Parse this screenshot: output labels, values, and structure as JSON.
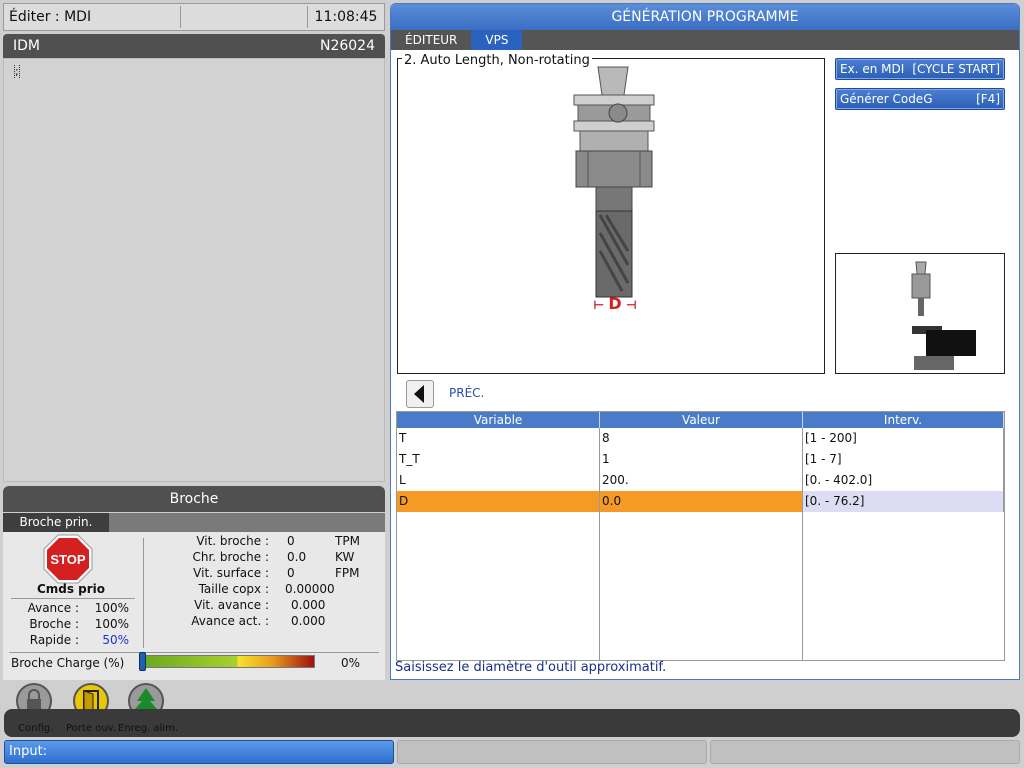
{
  "topbar": {
    "title": "Éditer : MDI",
    "clock": "11:08:45"
  },
  "idm": {
    "label": "IDM",
    "line": "N26024",
    "cursor_char": ";"
  },
  "broche": {
    "title": "Broche",
    "tab": "Broche prin.",
    "stop_label": "STOP",
    "cmds_label": "Cmds prio",
    "overrides": [
      {
        "label": "Avance :",
        "value": "100%"
      },
      {
        "label": "Broche :",
        "value": "100%"
      },
      {
        "label": "Rapide :",
        "value": "50%"
      }
    ],
    "stats": [
      {
        "label": "Vit. broche :",
        "value": "0",
        "unit": "TPM"
      },
      {
        "label": "Chr. broche :",
        "value": "0.0",
        "unit": "KW"
      },
      {
        "label": "Vit. surface :",
        "value": "0",
        "unit": "FPM"
      },
      {
        "label": "Taille copx :",
        "value": "0.00000",
        "unit": ""
      },
      {
        "label": "Vit. avance :",
        "value": "0.000",
        "unit": ""
      },
      {
        "label": "Avance act. :",
        "value": "0.000",
        "unit": ""
      }
    ],
    "charge_label": "Broche Charge (%)",
    "charge_value": "0%",
    "charge_fraction": 0
  },
  "generation": {
    "title": "GÉNÉRATION PROGRAMME",
    "tabs": [
      "ÉDITEUR",
      "VPS"
    ],
    "active_tab": "VPS",
    "image_title": "2. Auto Length, Non-rotating",
    "dimension_label": "D",
    "buttons": [
      {
        "label": "Ex. en MDI",
        "key": "[CYCLE START]"
      },
      {
        "label": "Générer CodeG",
        "key": "[F4]"
      }
    ],
    "prev_label": "PRÉC.",
    "table": {
      "headers": [
        "Variable",
        "Valeur",
        "Interv."
      ],
      "rows": [
        {
          "var": "T",
          "val": "8",
          "range": "[1 - 200]"
        },
        {
          "var": "T_T",
          "val": "1",
          "range": "[1 - 7]"
        },
        {
          "var": "L",
          "val": "200.",
          "range": "[0. - 402.0]"
        },
        {
          "var": "D",
          "val": "0.0",
          "range": "[0. - 76.2]"
        }
      ],
      "selected_row": 3
    },
    "hint": "Saisissez le diamètre d'outil approximatif."
  },
  "bottom": {
    "icons": [
      {
        "label": "Config.",
        "icon": "lock-icon"
      },
      {
        "label": "Porte ouv.",
        "icon": "door-icon"
      },
      {
        "label": "Enreg. alim.",
        "icon": "tree-icon"
      }
    ]
  },
  "input": {
    "label": "Input:"
  },
  "colors": {
    "accent": "#2a62c0",
    "selected_row": "#f59a25",
    "stop_red": "#d42020",
    "rapide_blue": "#2030d0"
  }
}
